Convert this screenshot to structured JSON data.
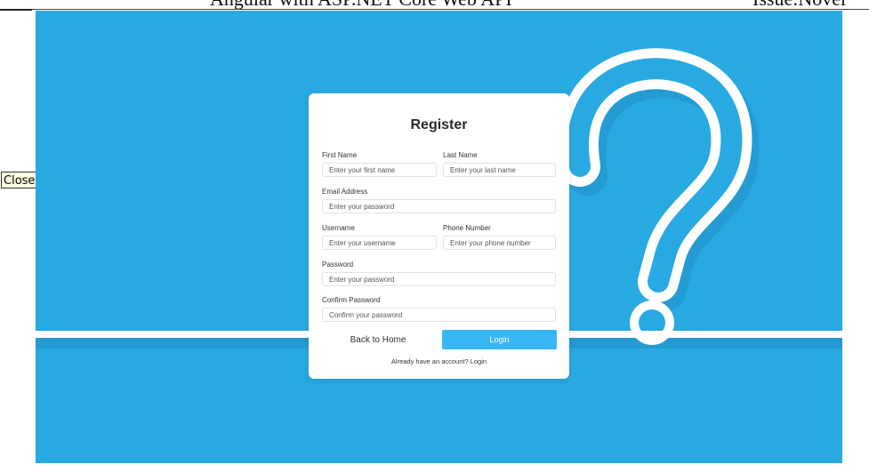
{
  "document_header": {
    "title_fragment": "Angular with ASP.NET Core Web API",
    "right_fragment": "Issue:Novel"
  },
  "overlay": {
    "close_label": "Close"
  },
  "register_form": {
    "title": "Register",
    "first_name": {
      "label": "First Name",
      "placeholder": "Enter your first name"
    },
    "last_name": {
      "label": "Last Name",
      "placeholder": "Enter your last name"
    },
    "email": {
      "label": "Email Address",
      "placeholder": "Enter your password"
    },
    "username": {
      "label": "Username",
      "placeholder": "Enter your username"
    },
    "phone": {
      "label": "Phone Number",
      "placeholder": "Enter your phone number"
    },
    "password": {
      "label": "Password",
      "placeholder": "Enter your password"
    },
    "confirm_password": {
      "label": "Confirm Password",
      "placeholder": "Confirm your password"
    },
    "back_label": "Back to Home",
    "login_label": "Login",
    "footer_text": "Already have an account? Login"
  },
  "colors": {
    "background": "#29a9e1",
    "login_button": "#38b6f4",
    "card": "#ffffff"
  }
}
